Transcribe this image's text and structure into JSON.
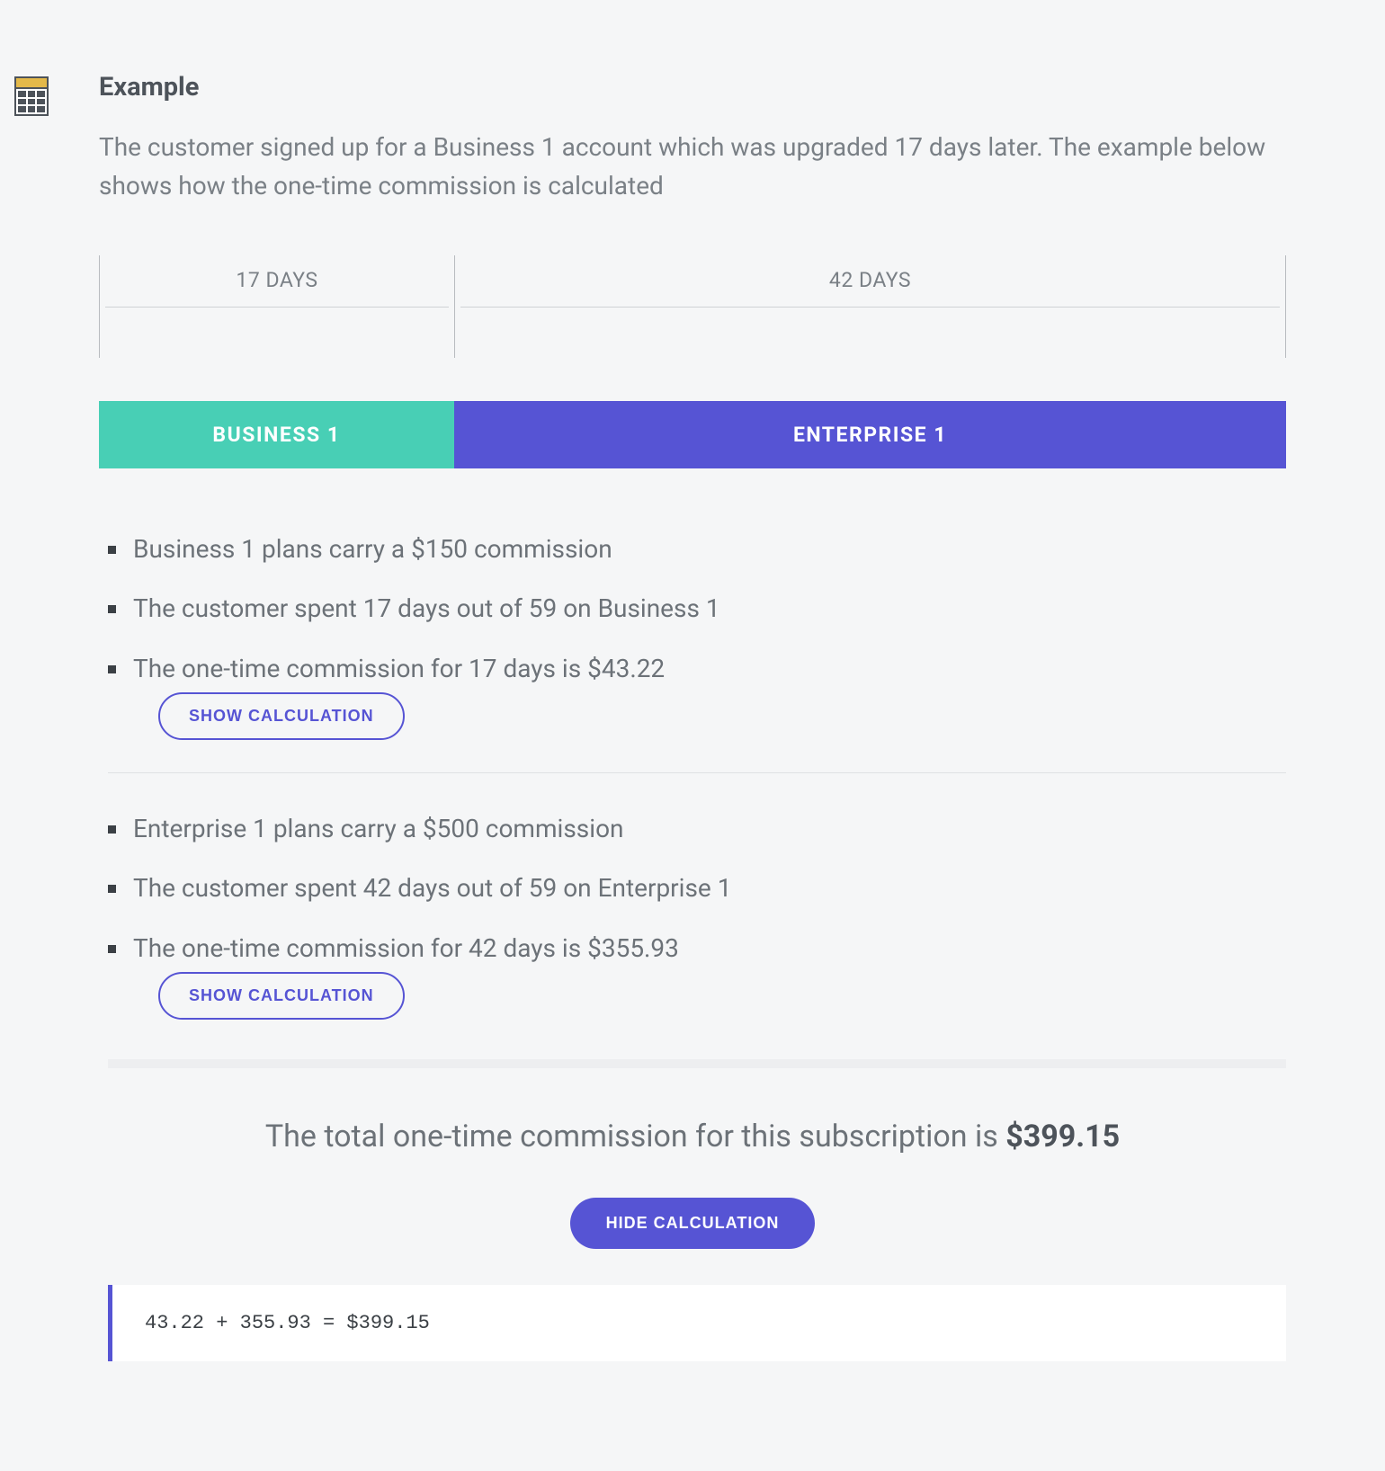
{
  "title": "Example",
  "intro": "The customer signed up for a Business 1 account which was upgraded 17 days later. The example below shows how the one-time commission is calculated",
  "timeline": {
    "segA": "17 DAYS",
    "segB": "42 DAYS"
  },
  "planbar": {
    "a": "BUSINESS 1",
    "b": "ENTERPRISE 1"
  },
  "biz": {
    "f1": "Business 1 plans carry a $150 commission",
    "f2": "The customer spent 17 days out of 59 on Business 1",
    "f3": "The one-time commission for 17 days is $43.22",
    "btn": "SHOW CALCULATION"
  },
  "ent": {
    "f1": "Enterprise 1 plans carry a $500 commission",
    "f2": "The customer spent 42 days out of 59 on Enterprise 1",
    "f3": "The one-time commission for 42 days is $355.93",
    "btn": "SHOW CALCULATION"
  },
  "total": {
    "prefix": "The total one-time commission for this subscription is ",
    "amount": "$399.15",
    "hideBtn": "HIDE CALCULATION",
    "calc": "43.22 + 355.93 = $399.15"
  }
}
